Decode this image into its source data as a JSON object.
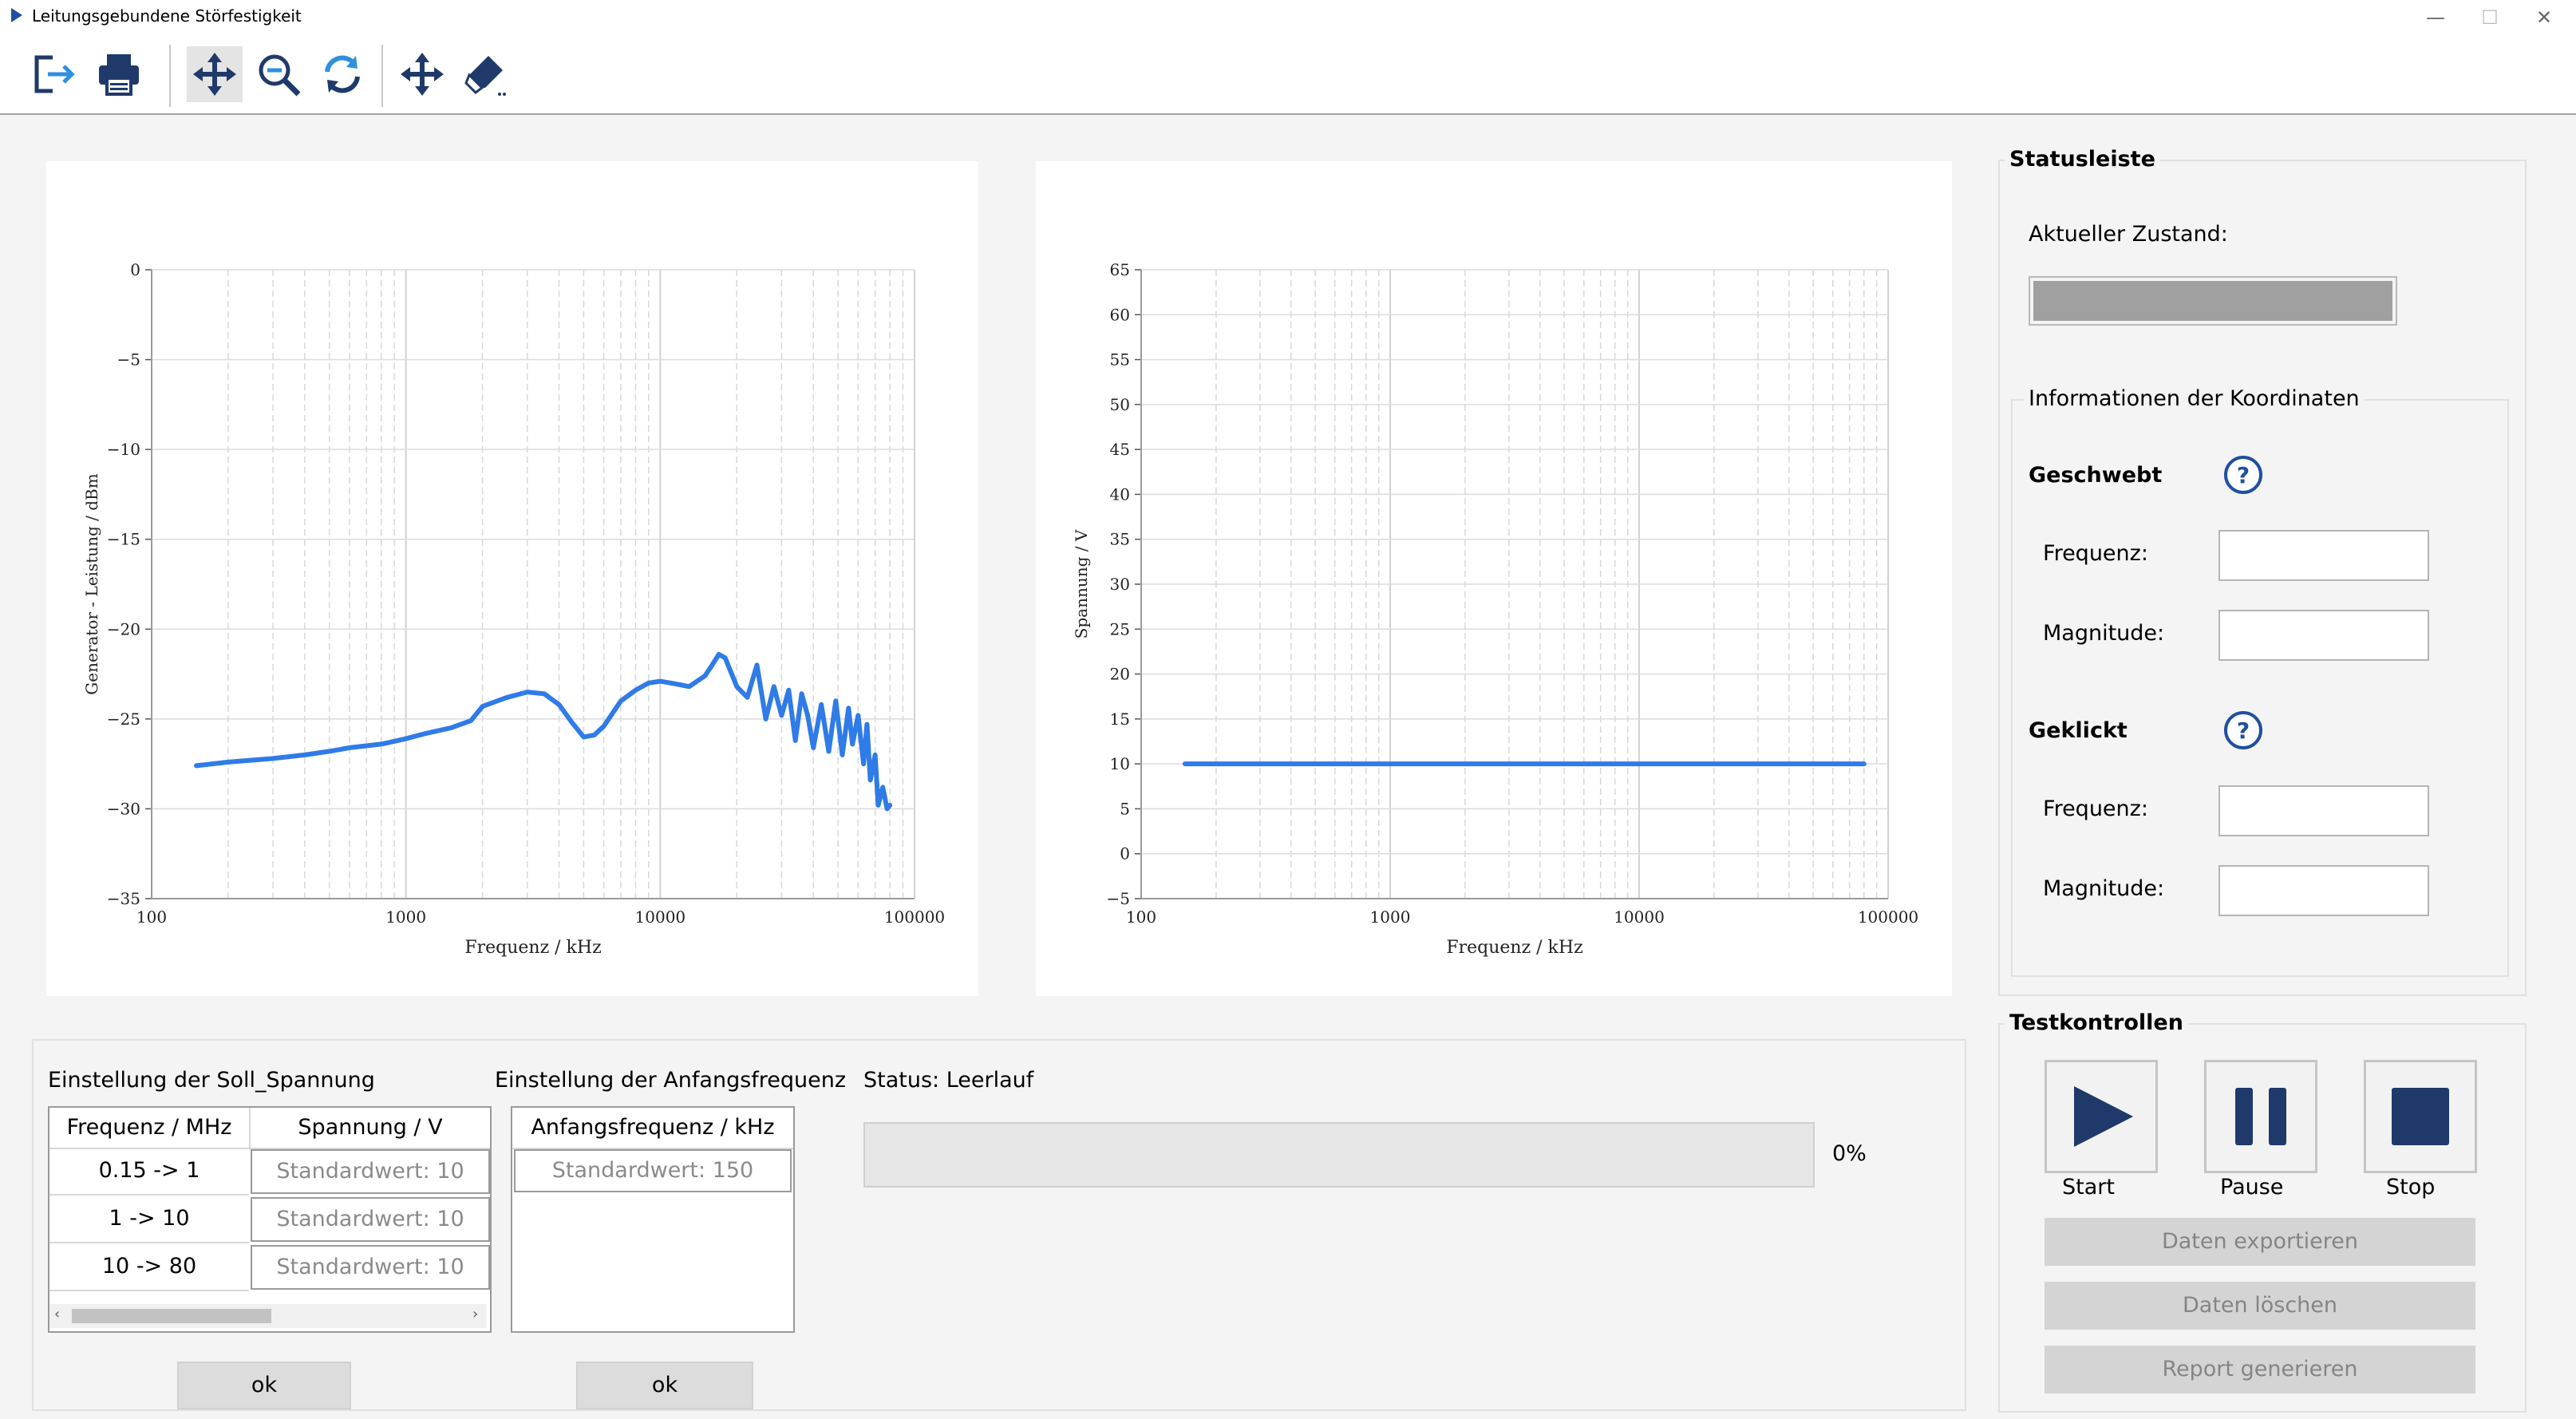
{
  "window": {
    "title": "Leitungsgebundene Störfestigkeit",
    "buttons": [
      "—",
      "☐",
      "✕"
    ]
  },
  "toolbar": {
    "icons": [
      "exit-icon",
      "print-icon",
      "pan-icon",
      "zoom-out-icon",
      "refresh-icon",
      "move-icon",
      "eraser-icon"
    ]
  },
  "plot_left": {
    "xlabel": "Frequenz / kHz",
    "ylabel": "Generator - Leistung / dBm"
  },
  "plot_right": {
    "xlabel": "Frequenz / kHz",
    "ylabel": "Spannung / V"
  },
  "chart_data": [
    {
      "type": "line",
      "xscale": "log",
      "xlim": [
        100,
        100000
      ],
      "ylim": [
        -35,
        0
      ],
      "xticks": [
        "100",
        "1000",
        "10000",
        "100000"
      ],
      "yticks": [
        "0",
        "−5",
        "−10",
        "−15",
        "−20",
        "−25",
        "−30",
        "−35"
      ],
      "xlabel": "Frequenz / kHz",
      "ylabel": "Generator - Leistung / dBm",
      "grid": true,
      "color": "#2f7be8",
      "series": [
        {
          "x": [
            150,
            200,
            300,
            400,
            500,
            600,
            800,
            1000,
            1200,
            1500,
            1800,
            2000,
            2500,
            3000,
            3500,
            4000,
            4500,
            5000,
            5500,
            6000,
            7000,
            8000,
            9000,
            10000,
            11000,
            12000,
            13000,
            15000,
            16000,
            17000,
            18000,
            20000,
            22000,
            24000,
            26000,
            28000,
            30000,
            32000,
            34000,
            36000,
            38000,
            40000,
            43000,
            46000,
            49000,
            52000,
            55000,
            57000,
            60000,
            63000,
            65000,
            67000,
            70000,
            72000,
            75000,
            78000,
            80000
          ],
          "y": [
            -27.6,
            -27.4,
            -27.2,
            -27.0,
            -26.8,
            -26.6,
            -26.4,
            -26.1,
            -25.8,
            -25.5,
            -25.1,
            -24.3,
            -23.8,
            -23.5,
            -23.6,
            -24.2,
            -25.2,
            -26.0,
            -25.9,
            -25.4,
            -24.0,
            -23.4,
            -23.0,
            -22.9,
            -23.0,
            -23.1,
            -23.2,
            -22.6,
            -22.0,
            -21.4,
            -21.6,
            -23.2,
            -23.8,
            -22.0,
            -25.0,
            -23.2,
            -24.8,
            -23.4,
            -26.2,
            -23.6,
            -24.8,
            -26.6,
            -24.2,
            -26.8,
            -24.0,
            -27.0,
            -24.4,
            -26.4,
            -24.8,
            -27.5,
            -25.3,
            -28.4,
            -27.0,
            -29.8,
            -28.8,
            -30.0,
            -29.8
          ]
        }
      ]
    },
    {
      "type": "line",
      "xscale": "log",
      "xlim": [
        100,
        100000
      ],
      "ylim": [
        -5,
        65
      ],
      "xticks": [
        "100",
        "1000",
        "10000",
        "100000"
      ],
      "yticks": [
        "65",
        "60",
        "55",
        "50",
        "45",
        "40",
        "35",
        "30",
        "25",
        "20",
        "15",
        "10",
        "5",
        "0",
        "−5"
      ],
      "xlabel": "Frequenz / kHz",
      "ylabel": "Spannung / V",
      "grid": true,
      "color": "#2f7be8",
      "series": [
        {
          "x": [
            150,
            80000
          ],
          "y": [
            10,
            10
          ]
        }
      ]
    }
  ],
  "soll": {
    "title": "Einstellung der Soll_Spannung",
    "headers": [
      "Frequenz / MHz",
      "Spannung / V"
    ],
    "rows": [
      {
        "freq": "0.15 -> 1",
        "value": "Standardwert: 10"
      },
      {
        "freq": "1 -> 10",
        "value": "Standardwert: 10"
      },
      {
        "freq": "10 -> 80",
        "value": "Standardwert: 10"
      }
    ],
    "ok": "ok"
  },
  "anfang": {
    "title": "Einstellung der Anfangsfrequenz",
    "header": "Anfangsfrequenz / kHz",
    "value": "Standardwert: 150",
    "ok": "ok"
  },
  "status": {
    "label": "Status: Leerlauf",
    "progress_label": "0%",
    "progress": 0
  },
  "statusleiste": {
    "title": "Statusleiste",
    "state_label": "Aktueller Zustand:",
    "state_color": "#a0a0a0",
    "coords_title": "Informationen der Koordinaten",
    "hover_title": "Geschwebt",
    "click_title": "Geklickt",
    "freq_label": "Frequenz:",
    "mag_label": "Magnitude:",
    "hover_freq": "",
    "hover_mag": "",
    "click_freq": "",
    "click_mag": ""
  },
  "testkontrollen": {
    "title": "Testkontrollen",
    "start": "Start",
    "pause": "Pause",
    "stop": "Stop",
    "export": "Daten exportieren",
    "delete": "Daten löschen",
    "report": "Report generieren"
  }
}
